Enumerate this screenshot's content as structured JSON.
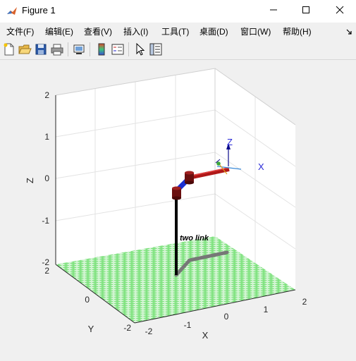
{
  "window": {
    "title": "Figure 1",
    "app_icon": "matlab-icon",
    "minimize_icon": "minimize-icon",
    "maximize_icon": "maximize-icon",
    "close_icon": "close-icon"
  },
  "menu": {
    "items": [
      "文件(F)",
      "编辑(E)",
      "查看(V)",
      "插入(I)",
      "工具(T)",
      "桌面(D)",
      "窗口(W)",
      "帮助(H)"
    ],
    "dock_icon": "dock-arrow-icon"
  },
  "toolbar": {
    "icons": [
      "new-figure-icon",
      "open-file-icon",
      "save-icon",
      "print-icon",
      "link-plot-icon",
      "colorbar-icon",
      "legend-icon",
      "edit-plot-icon",
      "property-inspector-icon"
    ]
  },
  "plot": {
    "axis_labels": {
      "x": "X",
      "y": "Y",
      "z": "Z"
    },
    "x_ticks": [
      "-2",
      "-1",
      "0",
      "1",
      "2"
    ],
    "y_ticks": [
      "-2",
      "0",
      "2"
    ],
    "z_ticks": [
      "-2",
      "-1",
      "0",
      "1",
      "2"
    ],
    "robot_name": "two link",
    "frame_labels": {
      "x": "X",
      "z": "Z"
    },
    "floor_colors": [
      "#7ee27e",
      "#d6f5d6"
    ],
    "link_colors": {
      "base": "#000000",
      "link1": "#1b2fd0",
      "link2": "#b01818",
      "shadow": "#777777"
    }
  }
}
